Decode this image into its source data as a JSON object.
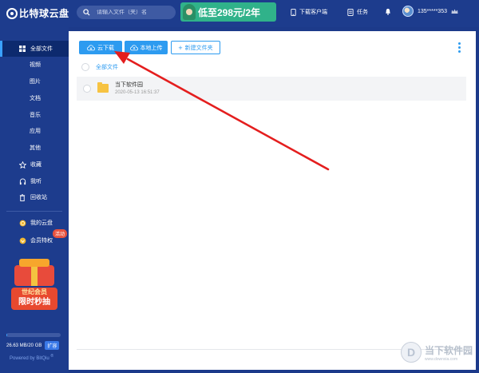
{
  "app": {
    "logo_text": "比特球云盘"
  },
  "topbar": {
    "search_placeholder": "请输入文件（夹）名",
    "promo_text": "低至298元/2年",
    "download_client_label": "下载客户端",
    "tasks_label": "任务",
    "username": "135*****353"
  },
  "sidebar": {
    "items": [
      {
        "label": "全部文件"
      },
      {
        "label": "视频"
      },
      {
        "label": "图片"
      },
      {
        "label": "文档"
      },
      {
        "label": "音乐"
      },
      {
        "label": "应用"
      },
      {
        "label": "其他"
      },
      {
        "label": "收藏"
      },
      {
        "label": "我听"
      },
      {
        "label": "回收站"
      },
      {
        "label": "我的云盘"
      },
      {
        "label": "会员特权"
      }
    ],
    "badge": "活动",
    "promo_line1": "世纪会员",
    "promo_line2": "限时秒抽",
    "storage_text": "26.63 MB/20 GB",
    "storage_used_fraction": 0.0013,
    "expand_label": "扩容",
    "powered_by": "Powered by BitQiu"
  },
  "toolbar": {
    "cloud_download": "云下载",
    "local_upload": "本地上传",
    "new_folder": "新建文件夹"
  },
  "breadcrumb": {
    "label": "全部文件"
  },
  "files": [
    {
      "name": "当下软件园",
      "time": "2020-05-13 16:51:37"
    }
  ],
  "watermark": {
    "cn": "当下软件园",
    "en": "www.downxia.com"
  },
  "colors": {
    "sidebar_bg": "#1d3c8d",
    "accent": "#2d9bf0",
    "annotation_arrow": "#e41e1e"
  }
}
